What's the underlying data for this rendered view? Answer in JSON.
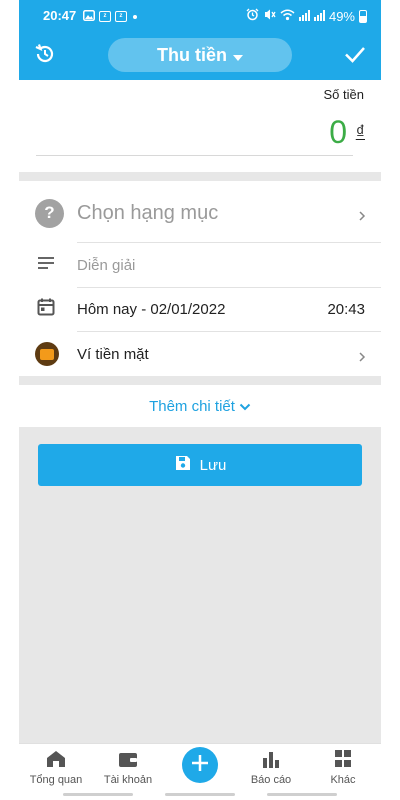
{
  "status_bar": {
    "time": "20:47",
    "battery": "49%",
    "notification_icons": [
      "image-icon",
      "zalo-icon",
      "zalo-icon"
    ]
  },
  "app_bar": {
    "title": "Thu tiền",
    "title_dropdown_icon": "caret-down-icon",
    "left_icon": "history-icon",
    "right_icon": "check-icon",
    "color": "#1fa9e8"
  },
  "amount": {
    "label": "Số tiền",
    "value": "0",
    "currency": "₫",
    "value_color": "#3cac46"
  },
  "form": {
    "category": {
      "placeholder": "Chọn hạng mục",
      "icon": "question-icon"
    },
    "description": {
      "placeholder": "Diễn giải",
      "icon": "notes-icon"
    },
    "date": {
      "label": "Hôm nay - 02/01/2022",
      "time": "20:43",
      "icon": "calendar-icon"
    },
    "wallet": {
      "label": "Ví tiền mặt",
      "icon": "wallet-icon"
    }
  },
  "more_details": {
    "label": "Thêm chi tiết",
    "icon": "chevron-down-icon",
    "color": "#1fa2e0"
  },
  "save_button": {
    "label": "Lưu",
    "icon": "floppy-disk-icon"
  },
  "bottom_nav": {
    "items": [
      {
        "label": "Tổng quan",
        "icon": "home-icon"
      },
      {
        "label": "Tài khoản",
        "icon": "wallet-icon"
      },
      {
        "label": "",
        "icon": "plus-icon"
      },
      {
        "label": "Báo cáo",
        "icon": "bar-chart-icon"
      },
      {
        "label": "Khác",
        "icon": "grid-icon"
      }
    ]
  }
}
